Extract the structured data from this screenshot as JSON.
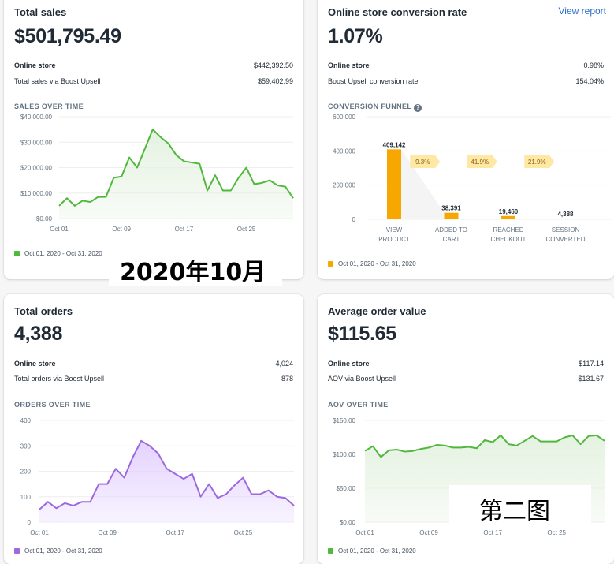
{
  "cards": {
    "sales": {
      "title": "Total sales",
      "value": "$501,795.49",
      "rows": [
        {
          "label": "Online store",
          "value": "$442,392.50"
        },
        {
          "label": "Total sales via Boost Upsell",
          "value": "$59,402.99"
        }
      ],
      "section_title": "SALES OVER TIME",
      "legend": "Oct 01, 2020 - Oct 31, 2020"
    },
    "conversion": {
      "title": "Online store conversion rate",
      "view_report": "View report",
      "value": "1.07%",
      "rows": [
        {
          "label": "Online store",
          "value": "0.98%"
        },
        {
          "label": "Boost Upsell conversion rate",
          "value": "154.04%"
        }
      ],
      "section_title": "CONVERSION FUNNEL",
      "help_icon": "?",
      "legend": "Oct 01, 2020 - Oct 31, 2020"
    },
    "orders": {
      "title": "Total orders",
      "value": "4,388",
      "rows": [
        {
          "label": "Online store",
          "value": "4,024"
        },
        {
          "label": "Total orders via Boost Upsell",
          "value": "878"
        }
      ],
      "section_title": "ORDERS OVER TIME",
      "legend": "Oct 01, 2020 - Oct 31, 2020"
    },
    "aov": {
      "title": "Average order value",
      "value": "$115.65",
      "rows": [
        {
          "label": "Online store",
          "value": "$117.14"
        },
        {
          "label": "AOV via Boost Upsell",
          "value": "$131.67"
        }
      ],
      "section_title": "AOV OVER TIME",
      "legend": "Oct 01, 2020 - Oct 31, 2020"
    }
  },
  "overlays": {
    "month_label": "2020年10月",
    "figure_label": "第二图"
  },
  "colors": {
    "green": "#50b83c",
    "green_fill": "#e3f1df",
    "purple": "#9c6ade",
    "purple_fill": "#e3d0ff",
    "orange": "#f7a800",
    "tag_bg": "#ffe8a3",
    "tag_text": "#8a6116"
  },
  "chart_data": [
    {
      "id": "sales",
      "type": "area",
      "title": "SALES OVER TIME",
      "x_tick_labels": [
        "Oct 01",
        "Oct 09",
        "Oct 17",
        "Oct 25"
      ],
      "y_tick_labels": [
        "$40,000.00",
        "$30,000.00",
        "$20,000.00",
        "$10,000.00",
        "$0.00"
      ],
      "ylim": [
        0,
        40000
      ],
      "y_ticks": [
        40000,
        30000,
        20000,
        10000,
        0
      ],
      "x_tick_positions": [
        0,
        8,
        16,
        24
      ],
      "series": [
        {
          "values": [
            5000,
            8000,
            5000,
            7000,
            6500,
            8500,
            8500,
            16000,
            16500,
            24000,
            20000,
            27500,
            35000,
            32000,
            29500,
            25000,
            22500,
            22000,
            21500,
            11000,
            17000,
            11000,
            11000,
            16000,
            20000,
            13500,
            14000,
            15000,
            13000,
            12500,
            8000
          ]
        }
      ]
    },
    {
      "id": "funnel",
      "type": "bar",
      "title": "CONVERSION FUNNEL",
      "y_tick_labels": [
        "600,000",
        "400,000",
        "200,000",
        "0"
      ],
      "y_ticks": [
        600000,
        400000,
        200000,
        0
      ],
      "ylim": [
        0,
        600000
      ],
      "categories": [
        [
          "VIEW",
          "PRODUCT"
        ],
        [
          "ADDED TO",
          "CART"
        ],
        [
          "REACHED",
          "CHECKOUT"
        ],
        [
          "SESSION",
          "CONVERTED"
        ]
      ],
      "values": [
        409142,
        38391,
        19460,
        4388
      ],
      "value_labels": [
        "409,142",
        "38,391",
        "19,460",
        "4,388"
      ],
      "step_rates": [
        "9.3%",
        "41.9%",
        "21.9%"
      ]
    },
    {
      "id": "orders",
      "type": "area",
      "title": "ORDERS OVER TIME",
      "x_tick_labels": [
        "Oct 01",
        "Oct 09",
        "Oct 17",
        "Oct 25"
      ],
      "y_tick_labels": [
        "400",
        "300",
        "200",
        "100",
        "0"
      ],
      "ylim": [
        0,
        400
      ],
      "y_ticks": [
        400,
        300,
        200,
        100,
        0
      ],
      "x_tick_positions": [
        0,
        8,
        16,
        24
      ],
      "series": [
        {
          "values": [
            50,
            80,
            55,
            75,
            65,
            80,
            80,
            150,
            150,
            210,
            175,
            255,
            320,
            300,
            270,
            210,
            190,
            170,
            190,
            100,
            150,
            95,
            110,
            145,
            175,
            110,
            110,
            125,
            100,
            95,
            65
          ]
        }
      ]
    },
    {
      "id": "aov",
      "type": "area",
      "title": "AOV OVER TIME",
      "x_tick_labels": [
        "Oct 01",
        "Oct 09",
        "Oct 17",
        "Oct 25"
      ],
      "y_tick_labels": [
        "$150.00",
        "$100.00",
        "$50.00",
        "$0.00"
      ],
      "ylim": [
        0,
        150
      ],
      "y_ticks": [
        150,
        100,
        50,
        0
      ],
      "x_tick_positions": [
        0,
        8,
        16,
        24
      ],
      "series": [
        {
          "values": [
            105,
            112,
            96,
            106,
            107,
            104,
            105,
            108,
            110,
            114,
            113,
            110,
            110,
            111,
            109,
            121,
            118,
            128,
            115,
            113,
            120,
            127,
            119,
            119,
            119,
            125,
            128,
            115,
            127,
            128,
            120
          ]
        }
      ]
    }
  ]
}
